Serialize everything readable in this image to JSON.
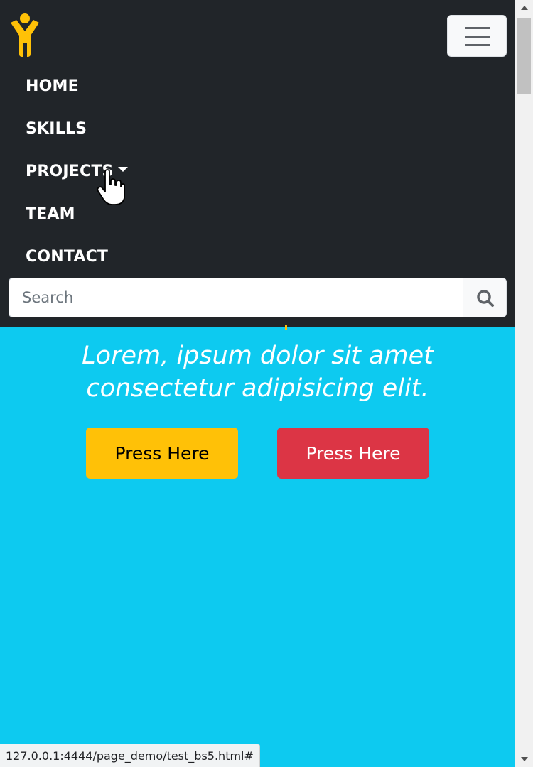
{
  "navbar": {
    "brand_icon": "accessibility-person-icon",
    "toggler_icon": "hamburger-menu-icon",
    "items": [
      {
        "label": "HOME"
      },
      {
        "label": "SKILLS"
      },
      {
        "label": "PROJECTS",
        "dropdown": true
      },
      {
        "label": "TEAM"
      },
      {
        "label": "CONTACT"
      }
    ]
  },
  "search": {
    "placeholder": "Search",
    "button_icon": "search-icon"
  },
  "hero": {
    "text": "Lorem, ipsum dolor sit amet consectetur adipisicing elit.",
    "buttons": [
      {
        "label": "Press Here",
        "color": "#ffc107"
      },
      {
        "label": "Press Here",
        "color": "#dc3545"
      }
    ]
  },
  "status_bar": {
    "url": "127.0.0.1:4444/page_demo/test_bs5.html#"
  },
  "colors": {
    "navbar_bg": "#212529",
    "hero_bg": "#0dcaf0",
    "brand": "#ffc107"
  }
}
